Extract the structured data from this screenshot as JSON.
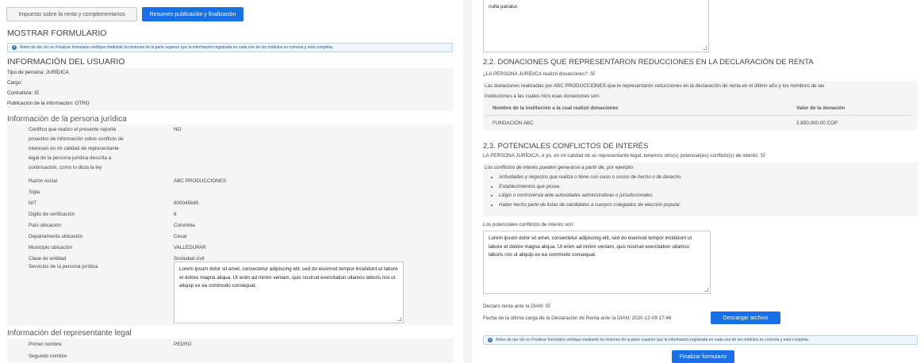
{
  "left": {
    "buttons": {
      "tab_tax": "Impuesto sobre la renta y complementarios",
      "tab_summary": "Resumen publicación y finalización"
    },
    "section_title": "MOSTRAR FORMULARIO",
    "alert_text": "Antes de dar clic en Finalizar formulario verifique mediante los botones de la parte superior que la información registrada en cada uno de los módulos es correcta y está completa.",
    "user_info": {
      "title": "INFORMACIÓN DEL USUARIO",
      "lines": [
        "Tipo de persona: JURÍDICA",
        "Cargo:",
        "Contratista: SÍ",
        "Publicación de la información: OTRO"
      ]
    },
    "juridica": {
      "title": "Información de la persona jurídica",
      "cert_label_lines": [
        "Certifico que realizo el presente reporte",
        "proactivo de información sobre conflicto de",
        "intereses en mi calidad de representante",
        "legal de la persona jurídica descrita a",
        "continuación, como lo dicta la ley"
      ],
      "cert_value": "NO",
      "fields": [
        {
          "label": "Razón social",
          "value": "ABC PRODUCCIONES"
        },
        {
          "label": "Sigla",
          "value": ""
        },
        {
          "label": "NIT",
          "value": "800045645"
        },
        {
          "label": "Digito de verificación",
          "value": "8"
        },
        {
          "label": "País ubicación",
          "value": "Colombia"
        },
        {
          "label": "Departamento ubicación",
          "value": "Cesar"
        },
        {
          "label": "Municipio ubicación",
          "value": "VALLEDUPAR"
        },
        {
          "label": "Clase de entidad",
          "value": "Sociedad civil"
        }
      ],
      "services_label": "Servicios de la persona jurídica",
      "services_text": "Lorem ipsum dolor sit amet, consectetur adipiscing elit, sed do eiusmod tempor incididunt ut labore et dolore magna aliqua. Ut enim ad minim veniam, quis nostrud exercitation ullamco laboris nisi ut aliquip ex ea commodo consequat."
    },
    "legal_rep": {
      "title": "Información del representante legal",
      "fields": [
        {
          "label": "Primer nombre",
          "value": "PEDRO"
        },
        {
          "label": "Segundo nombre",
          "value": ""
        }
      ]
    }
  },
  "right": {
    "top_box_text": "nulla pariatur.",
    "donations": {
      "title": "2.2. DONACIONES QUE REPRESENTARON REDUCCIONES EN LA DECLARACIÓN DE RENTA",
      "question": "¿LA PERSONA JURÍDICA realizó donaciones?: SÍ",
      "desc_line1": "Las donaciones realizadas por ABC PRODUCCIONES que le representaron reducciones en la declaración de renta en el último año y los nombres de las",
      "desc_line2": "instituciones a las cuales hizo esas donaciones son:",
      "col1": "Nombre de la institución a la cual realizó donaciones",
      "col2": "Valor de la donación",
      "rows": [
        {
          "name": "FUNDACIÓN ABC",
          "value": "2.850.000,00 COP"
        }
      ]
    },
    "conflicts": {
      "title": "2.3. POTENCIALES CONFLICTOS DE INTERÉS",
      "statement": "LA PERSONA JURÍDICA, o yo, en mi calidad de su representante legal, tenemos otro(s) potencial(es) conflicto(s) de interés: SÍ",
      "examples_intro": "Los conflictos de interés pueden generarse a partir de, por ejemplo:",
      "examples": [
        "Actividades y negocios que realiza o tiene con socio o socios de hecho o de derecho.",
        "Establecimientos que posee.",
        "Litigio o controversia ante autoridades administrativas o jurisdiccionales.",
        "Haber hecho parte de listas de candidatos a cuerpos colegiados de elección popular."
      ],
      "list_label": "Los potenciales conflictos de interés son:",
      "list_text": "Lorem ipsum dolor sit amet, consectetur adipiscing elit, sed do eiusmod tempor incididunt ut labore et dolore magna aliqua. Ut enim ad minim veniam, quis nostrud exercitation ullamco laboris nisi ut aliquip ex ea commodo consequat."
    },
    "declara": "Declaro renta ante la DIAN: SÍ",
    "last_upload": "Fecha de la última carga de la Declaración de Renta ante la DIAN: 2020-12-09 17:46",
    "download_button": "Descargar archivo",
    "alert_text": "Antes de dar clic en Finalizar formulario verifique mediante los botones de la parte superior que la información registrada en cada uno de los módulos es correcta y está completa.",
    "finalize_button": "Finalizar formulario"
  }
}
